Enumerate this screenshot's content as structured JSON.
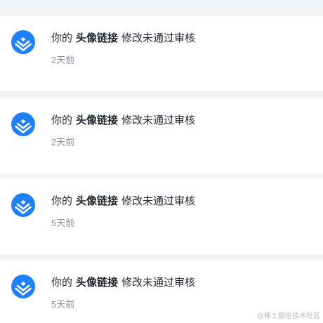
{
  "notifications": [
    {
      "prefix": "你的",
      "highlight": "头像链接",
      "suffix": "修改未通过审核",
      "time": "2天前"
    },
    {
      "prefix": "你的",
      "highlight": "头像链接",
      "suffix": "修改未通过审核",
      "time": "2天前"
    },
    {
      "prefix": "你的",
      "highlight": "头像链接",
      "suffix": "修改未通过审核",
      "time": "5天前"
    },
    {
      "prefix": "你的",
      "highlight": "头像链接",
      "suffix": "修改未通过审核",
      "time": "5天前"
    }
  ],
  "icons": {
    "avatar": "juejin-logo-icon"
  },
  "colors": {
    "brand": "#1e80ff",
    "background": "#f2f3f5",
    "card": "#ffffff",
    "text": "#252933",
    "muted": "#8a919f"
  },
  "watermark": "@稀土掘金技术社区"
}
